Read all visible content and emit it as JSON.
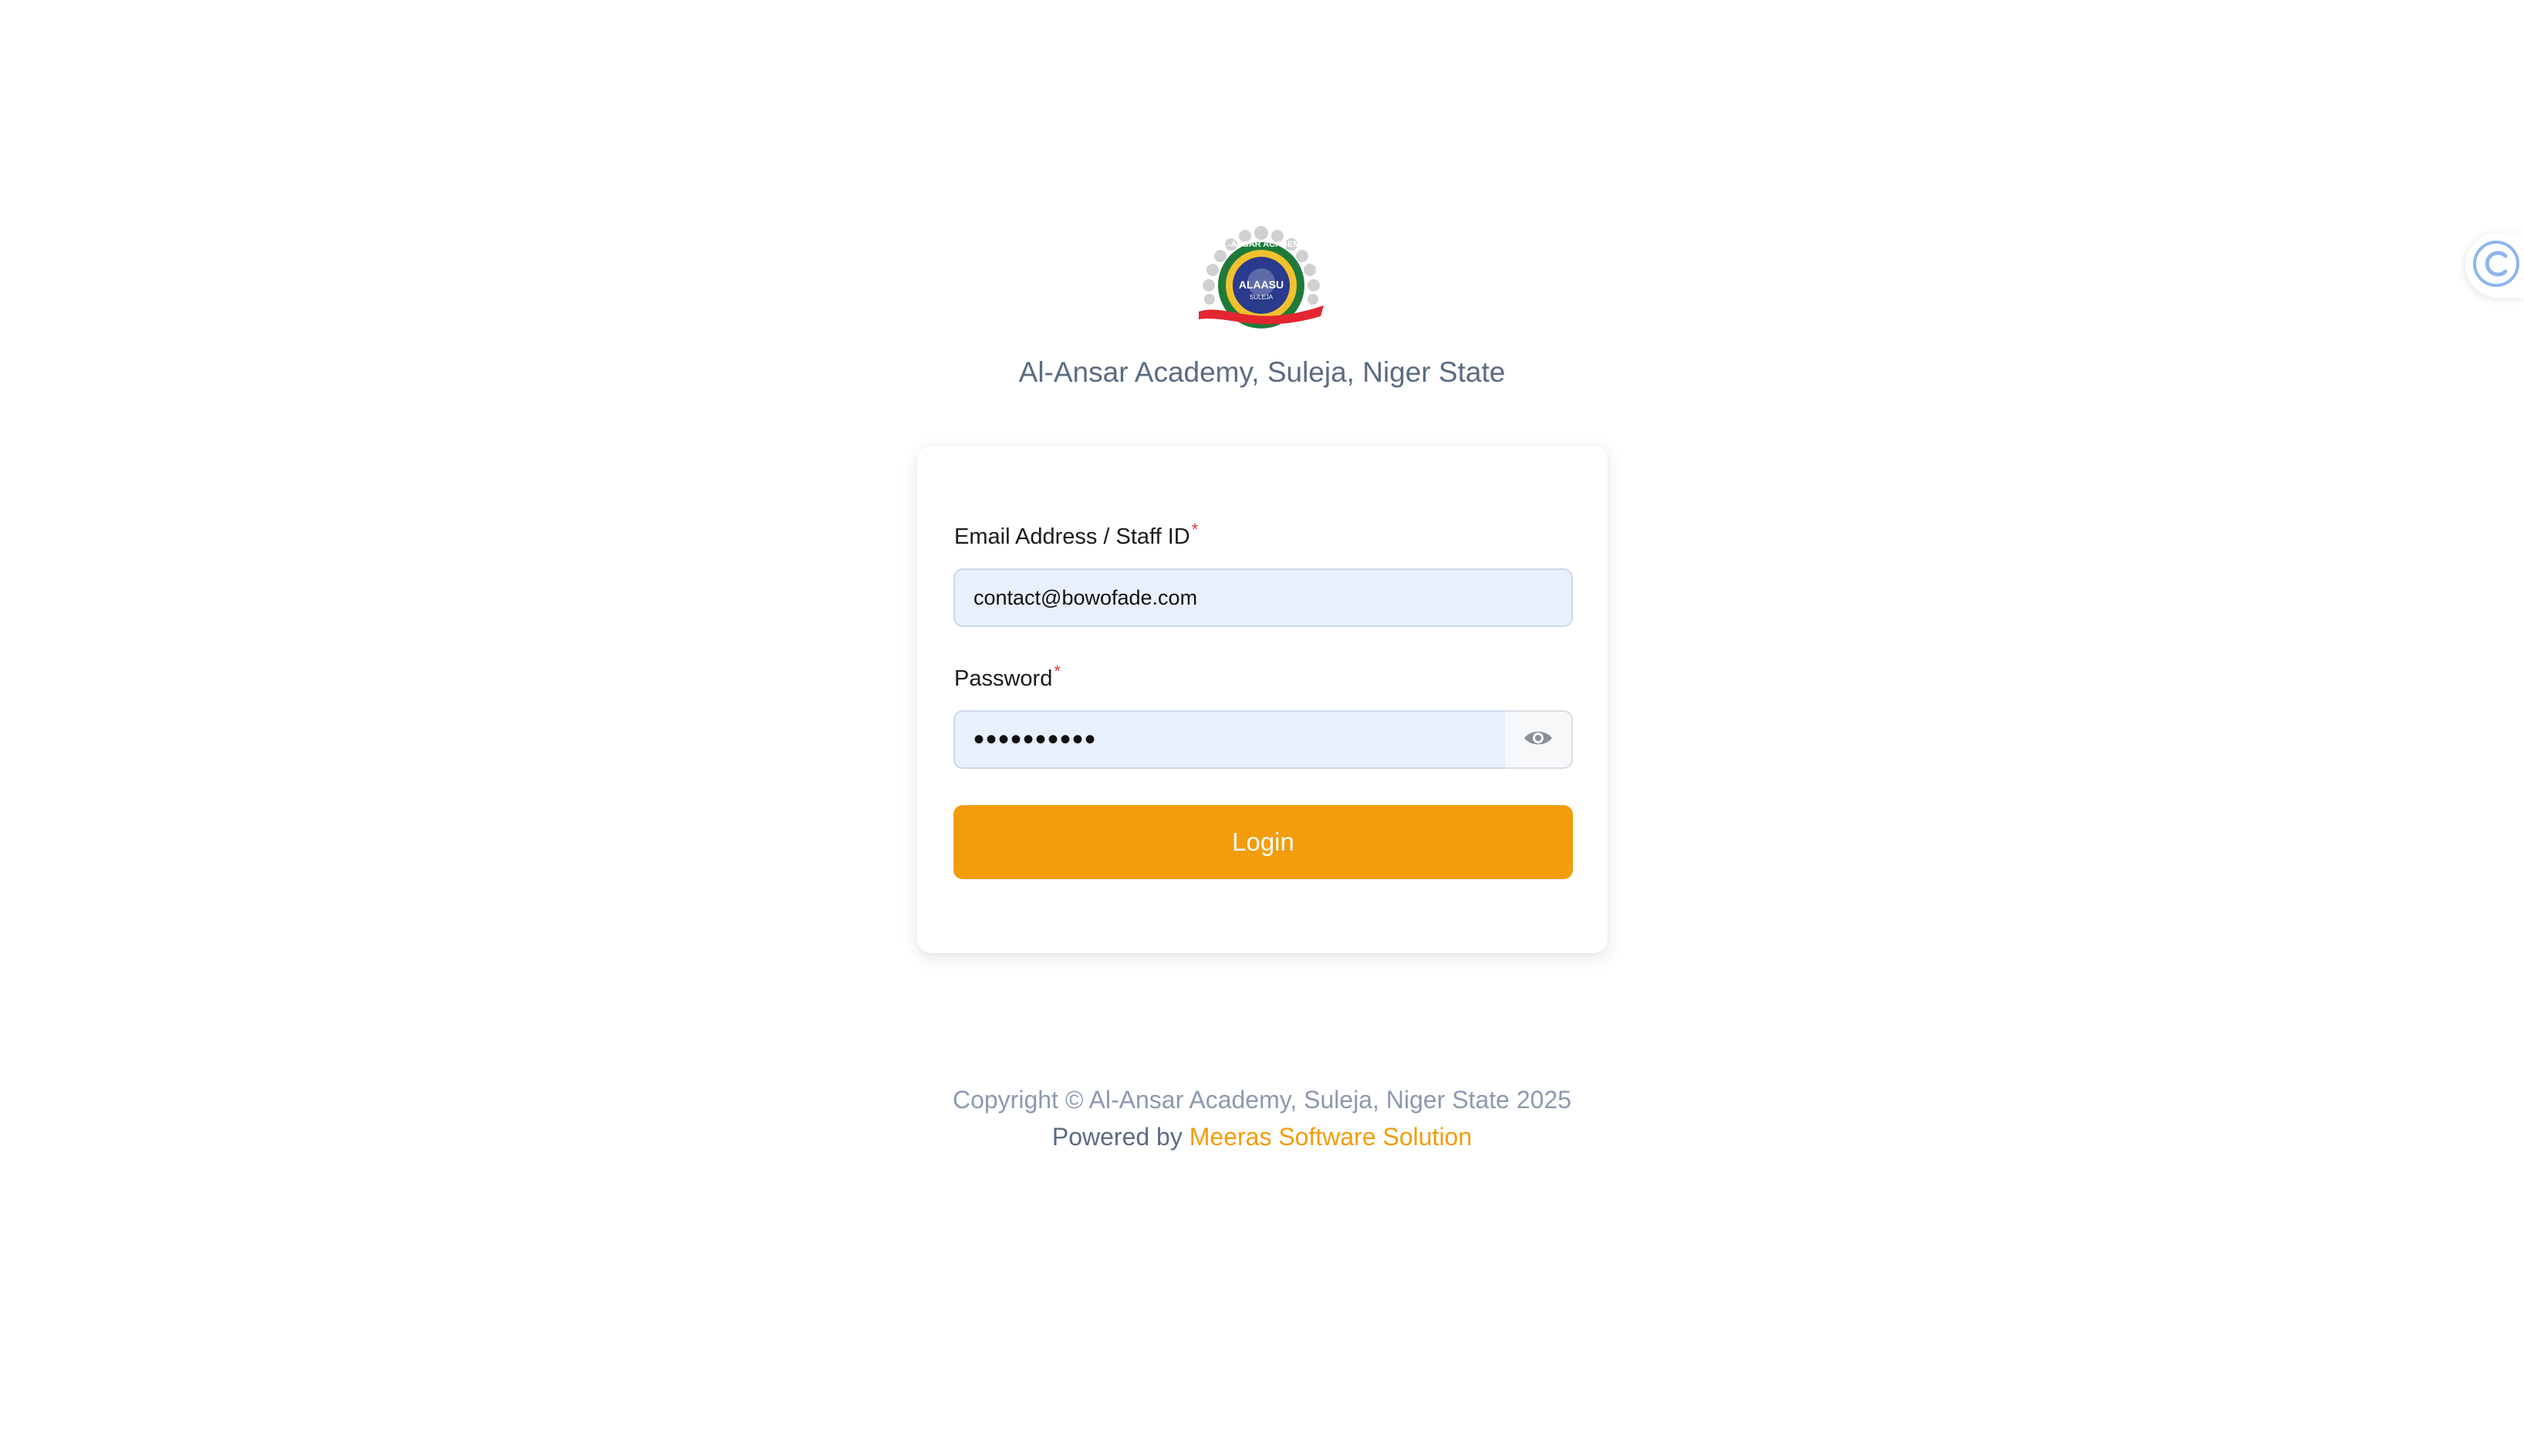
{
  "school": {
    "name": "Al-Ansar Academy, Suleja, Niger State",
    "logo_text": "AL-ANSAR ACADEMY",
    "logo_center": "ALAASU",
    "logo_sub": "SULEJA"
  },
  "form": {
    "email_label": "Email Address / Staff ID",
    "email_value": "contact@bowofade.com",
    "password_label": "Password",
    "password_value": "••••••••••",
    "required_marker": "*",
    "login_label": "Login"
  },
  "footer": {
    "copyright": "Copyright © Al-Ansar Academy, Suleja, Niger State 2025",
    "powered_prefix": "Powered by ",
    "powered_link": "Meeras Software Solution"
  },
  "colors": {
    "accent": "#f39c0c",
    "input_bg": "#e8f0fe",
    "title_text": "#5b6b83",
    "required": "#e53935"
  },
  "icons": {
    "password_toggle": "eye-icon",
    "side_widget": "assistant-c-icon"
  }
}
